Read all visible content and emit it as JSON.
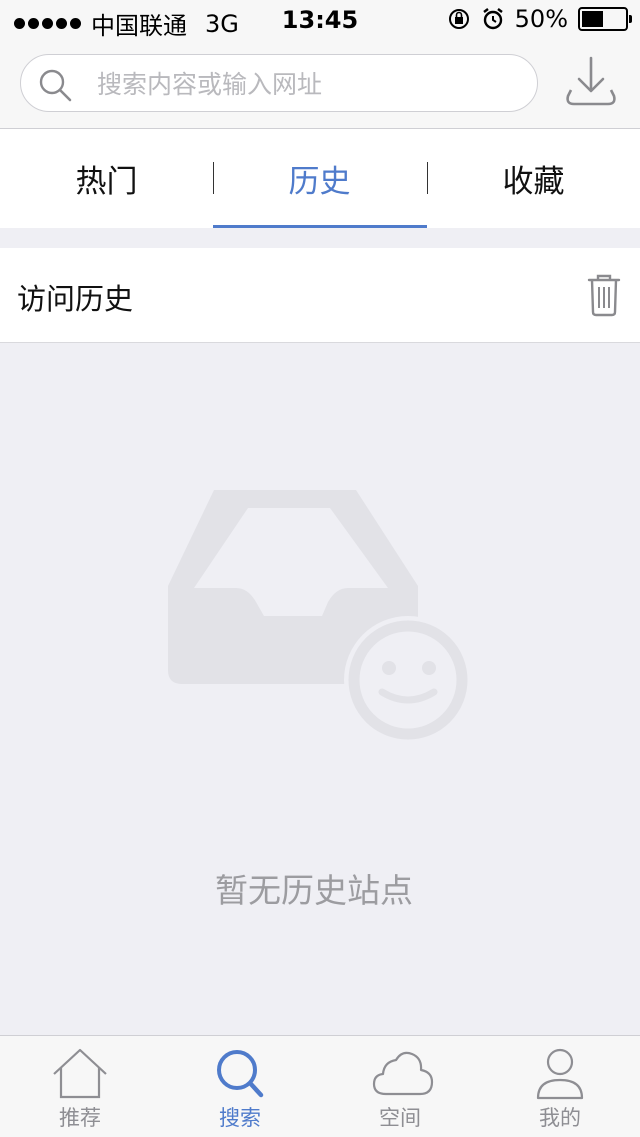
{
  "status_bar": {
    "carrier": "中国联通",
    "network": "3G",
    "time": "13:45",
    "battery": "50%",
    "battery_level": 0.5
  },
  "search": {
    "placeholder": "搜索内容或输入网址",
    "value": ""
  },
  "tabs": [
    {
      "label": "热门",
      "active": false
    },
    {
      "label": "历史",
      "active": true
    },
    {
      "label": "收藏",
      "active": false
    }
  ],
  "section": {
    "title": "访问历史"
  },
  "empty_state": {
    "message": "暂无历史站点"
  },
  "tab_bar": [
    {
      "label": "推荐",
      "icon": "home-icon",
      "active": false
    },
    {
      "label": "搜索",
      "icon": "search-icon",
      "active": true
    },
    {
      "label": "空间",
      "icon": "cloud-icon",
      "active": false
    },
    {
      "label": "我的",
      "icon": "person-icon",
      "active": false
    }
  ],
  "colors": {
    "accent": "#4f7bcb",
    "inactive": "#8e8e93",
    "background": "#efeff4"
  }
}
